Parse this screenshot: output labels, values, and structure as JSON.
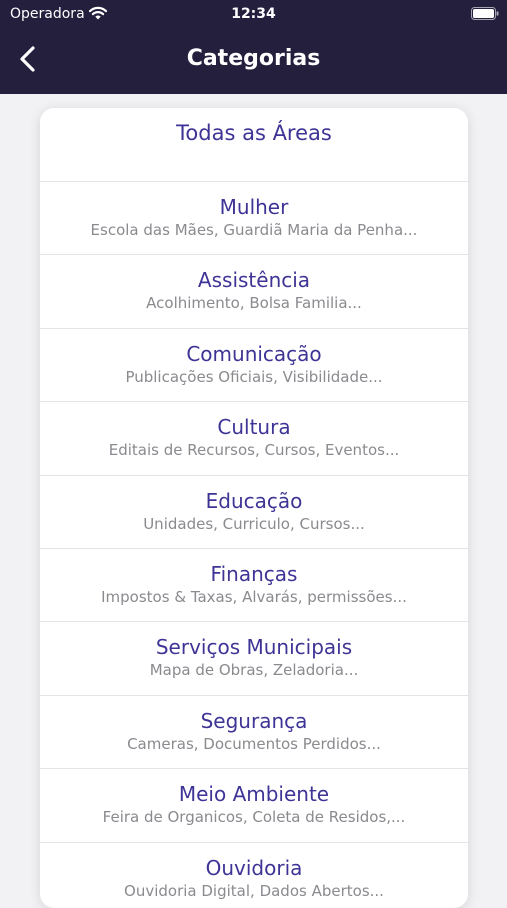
{
  "status_bar": {
    "carrier": "Operadora",
    "time": "12:34"
  },
  "nav": {
    "title": "Categorias",
    "back_icon": "chevron-left-icon"
  },
  "all_areas": {
    "label": "Todas as Áreas"
  },
  "categories": [
    {
      "title": "Mulher",
      "subtitle": "Escola das Mães, Guardiã Maria da Penha..."
    },
    {
      "title": "Assistência",
      "subtitle": "Acolhimento, Bolsa Familia..."
    },
    {
      "title": "Comunicação",
      "subtitle": "Publicações Oficiais, Visibilidade..."
    },
    {
      "title": "Cultura",
      "subtitle": "Editais de Recursos, Cursos, Eventos..."
    },
    {
      "title": "Educação",
      "subtitle": "Unidades, Curriculo, Cursos..."
    },
    {
      "title": "Finanças",
      "subtitle": "Impostos & Taxas, Alvarás, permissões..."
    },
    {
      "title": "Serviços Municipais",
      "subtitle": "Mapa de Obras, Zeladoria..."
    },
    {
      "title": "Segurança",
      "subtitle": "Cameras, Documentos Perdidos..."
    },
    {
      "title": "Meio Ambiente",
      "subtitle": "Feira de Organicos, Coleta de Residos,..."
    },
    {
      "title": "Ouvidoria",
      "subtitle": "Ouvidoria Digital, Dados Abertos..."
    }
  ],
  "colors": {
    "header_bg": "#231f3d",
    "accent": "#3e3496",
    "subtitle": "#8a8a8f"
  }
}
